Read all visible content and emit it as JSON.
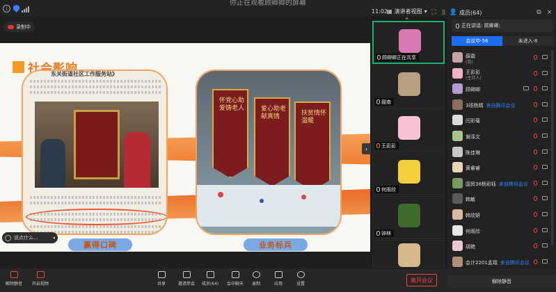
{
  "window": {
    "title": "你正在观看顾卿卿的屏幕",
    "time": "11:02",
    "view_mode": "演讲者视图",
    "recording": "录制中"
  },
  "slide": {
    "title": "社会影响",
    "headline": "东关街道社区工作服务站》",
    "left_caption": "赢得口碑",
    "right_caption": "业务标兵",
    "pennants": [
      "怀党心助爱铸老人",
      "爱心助老献真情",
      "扶贫情怀温暖"
    ]
  },
  "chat": {
    "placeholder": "说点什么..."
  },
  "video_strip": {
    "tiles": [
      {
        "name": "顾卿卿正在共享",
        "color": "#d77ab3"
      },
      {
        "name": "聂南",
        "color": "#b9a080"
      },
      {
        "name": "王彭彭",
        "color": "#f6c1d4"
      },
      {
        "name": "何雨欣",
        "color": "#f3cf3d"
      },
      {
        "name": "钟林",
        "color": "#3c6b2a"
      },
      {
        "name": "",
        "color": "#d8b88b"
      }
    ]
  },
  "panel": {
    "header": "成员(64)",
    "speaking": "正在讲话: 顾卿卿;",
    "tabs": [
      "会议中·56",
      "未进入·8"
    ],
    "members": [
      {
        "name": "薛霜",
        "sub": "(我)",
        "tag": "",
        "color": "#c7a3a8"
      },
      {
        "name": "王彭彭",
        "sub": "(主持人)",
        "tag": "",
        "color": "#f0b3c6"
      },
      {
        "name": "顾卿卿",
        "sub": "",
        "tag": "",
        "color": "#b59bd4"
      },
      {
        "name": "3班杨晴",
        "sub": "",
        "tag": "来自腾讯会议",
        "color": "#8a6f5d"
      },
      {
        "name": "闫彩菊",
        "sub": "",
        "tag": "",
        "color": "#dcdcdc"
      },
      {
        "name": "谢泽文",
        "sub": "",
        "tag": "",
        "color": "#a9c38f"
      },
      {
        "name": "陈佳琳",
        "sub": "",
        "tag": "",
        "color": "#c7c7c7"
      },
      {
        "name": "黄睿睿",
        "sub": "",
        "tag": "",
        "color": "#e8d4b6"
      },
      {
        "name": "国贸38杨彩钰",
        "sub": "",
        "tag": "来自腾讯会议",
        "color": "#7a9a62"
      },
      {
        "name": "韩敏",
        "sub": "",
        "tag": "",
        "color": "#5b5b5b"
      },
      {
        "name": "韩欣妍",
        "sub": "",
        "tag": "",
        "color": "#d7b9a0"
      },
      {
        "name": "何雨欣",
        "sub": "",
        "tag": "",
        "color": "#e6e6e6"
      },
      {
        "name": "胡艳",
        "sub": "",
        "tag": "",
        "color": "#e7c5d2"
      },
      {
        "name": "会计2201孟瑶",
        "sub": "",
        "tag": "来自腾讯会议",
        "color": "#b08e7a"
      }
    ]
  },
  "bottom": {
    "buttons": [
      "解除静音",
      "开启视频",
      "共享",
      "邀请参会",
      "成员(64)",
      "会中聊天",
      "录制",
      "应用",
      "设置"
    ],
    "leave": "离开会议",
    "unmute_all": "解除静音"
  }
}
